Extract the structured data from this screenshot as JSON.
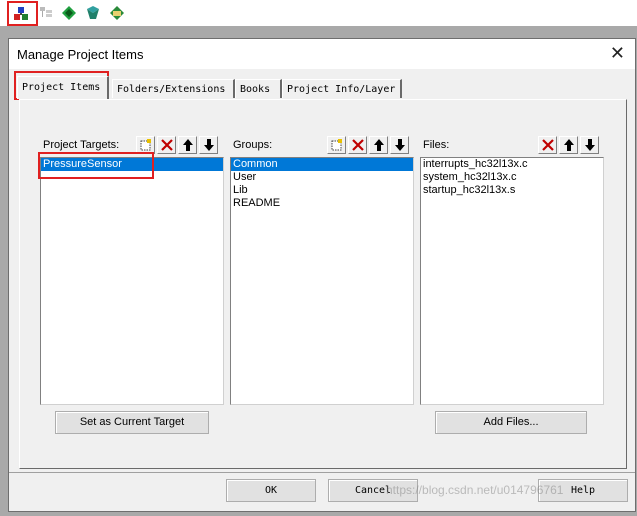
{
  "toolbar": {
    "buttons": [
      {
        "name": "manage-project-items-icon"
      },
      {
        "name": "file-extensions-icon"
      },
      {
        "name": "batch-build-icon"
      },
      {
        "name": "options-for-target-icon"
      },
      {
        "name": "pack-installer-icon"
      }
    ]
  },
  "dialog": {
    "title": "Manage Project Items",
    "close_glyph": "✕",
    "tabs": [
      "Project Items",
      "Folders/Extensions",
      "Books",
      "Project Info/Layer"
    ],
    "active_tab": 0,
    "targets": {
      "label": "Project Targets:",
      "items": [
        "PressureSensor"
      ],
      "selected": 0
    },
    "groups": {
      "label": "Groups:",
      "items": [
        "Common",
        "User",
        "Lib",
        "README"
      ],
      "selected": 0
    },
    "files": {
      "label": "Files:",
      "items": [
        "interrupts_hc32l13x.c",
        "system_hc32l13x.c",
        "startup_hc32l13x.s"
      ]
    },
    "set_target_label": "Set as Current Target",
    "add_files_label": "Add Files...",
    "ok_label": "OK",
    "cancel_label": "Cancel",
    "help_label": "Help"
  },
  "watermark": "https://blog.csdn.net/u014796761",
  "colors": {
    "selection": "#0078d7",
    "highlight_box": "#e02020",
    "delete_red": "#c00000"
  }
}
